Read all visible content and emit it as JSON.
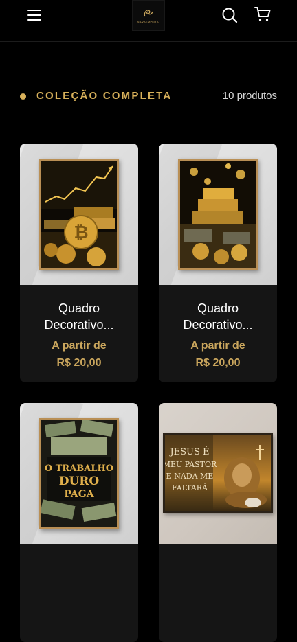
{
  "header": {
    "logo_text": "SILVAEMPERIO",
    "icons": [
      "hamburger-menu-icon",
      "search-icon",
      "cart-icon"
    ]
  },
  "section": {
    "title": "COLEÇÃO COMPLETA",
    "count": "10 produtos",
    "accent_color": "#d8b15b"
  },
  "products": [
    {
      "name_line1": "Quadro",
      "name_line2": "Decorativo...",
      "price_label": "A partir de",
      "price": "R$ 20,00",
      "art": "bitcoin-gold-chart"
    },
    {
      "name_line1": "Quadro",
      "name_line2": "Decorativo...",
      "price_label": "A partir de",
      "price": "R$ 20,00",
      "art": "gold-bars-money"
    },
    {
      "art": "o-trabalho-duro-paga",
      "art_text": [
        "O TRABALHO",
        "DURO",
        "PAGA"
      ]
    },
    {
      "art": "jesus-lion",
      "art_text": [
        "JESUS É",
        "MEU PASTOR",
        "E NADA ME",
        "FALTARÁ"
      ]
    }
  ]
}
